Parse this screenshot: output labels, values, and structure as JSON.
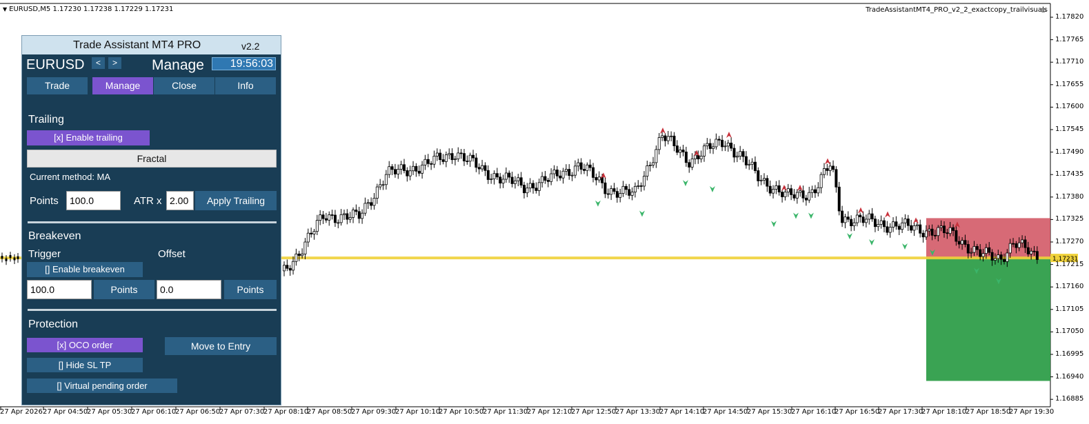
{
  "chart": {
    "header": "EURUSD,M5  1.17230 1.17238 1.17229 1.17231",
    "ea_name": "TradeAssistantMT4_PRO_v2_2_exactcopy_trailvisuals",
    "price_labels": [
      "1.17820",
      "1.17765",
      "1.17710",
      "1.17655",
      "1.17600",
      "1.17545",
      "1.17490",
      "1.17435",
      "1.17380",
      "1.17325",
      "1.17270",
      "1.17215",
      "1.17160",
      "1.17105",
      "1.17050",
      "1.16995",
      "1.16940",
      "1.16885"
    ],
    "current_price": "1.17231",
    "time_labels": [
      "27 Apr 2026",
      "27 Apr 04:50",
      "27 Apr 05:30",
      "27 Apr 06:10",
      "27 Apr 06:50",
      "27 Apr 07:30",
      "27 Apr 08:10",
      "27 Apr 08:50",
      "27 Apr 09:30",
      "27 Apr 10:10",
      "27 Apr 10:50",
      "27 Apr 11:30",
      "27 Apr 12:10",
      "27 Apr 12:50",
      "27 Apr 13:30",
      "27 Apr 14:10",
      "27 Apr 14:50",
      "27 Apr 15:30",
      "27 Apr 16:10",
      "27 Apr 16:50",
      "27 Apr 17:30",
      "27 Apr 18:10",
      "27 Apr 18:50",
      "27 Apr 19:30"
    ],
    "colors": {
      "sl_zone": "#d0505e",
      "tp_zone": "#2f9e4a",
      "price_line": "#f0d23a",
      "bull": "#ffffff",
      "bear": "#000000"
    }
  },
  "panel": {
    "title": "Trade Assistant MT4 PRO",
    "version": "v2.2",
    "symbol": "EURUSD",
    "prev_label": "<",
    "next_label": ">",
    "mode": "Manage",
    "clock": "19:56:03",
    "tabs": [
      {
        "label": "Trade"
      },
      {
        "label": "Manage",
        "active": true
      },
      {
        "label": "Close"
      },
      {
        "label": "Info"
      }
    ],
    "trailing": {
      "heading": "Trailing",
      "enable_label": "[x] Enable trailing",
      "method_button": "Fractal",
      "current_method": "Current method: MA",
      "points_label": "Points",
      "points_value": "100.0",
      "atr_label": "ATR x",
      "atr_value": "2.00",
      "apply_label": "Apply Trailing"
    },
    "breakeven": {
      "heading": "Breakeven",
      "trigger_label": "Trigger",
      "offset_label": "Offset",
      "enable_label": "[] Enable breakeven",
      "trigger_value": "100.0",
      "trigger_points": "Points",
      "offset_value": "0.0",
      "offset_points": "Points"
    },
    "protection": {
      "heading": "Protection",
      "oco_label": "[x] OCO order",
      "move_label": "Move to Entry",
      "hide_label": "[] Hide SL TP",
      "virtual_label": "[] Virtual pending order"
    }
  }
}
